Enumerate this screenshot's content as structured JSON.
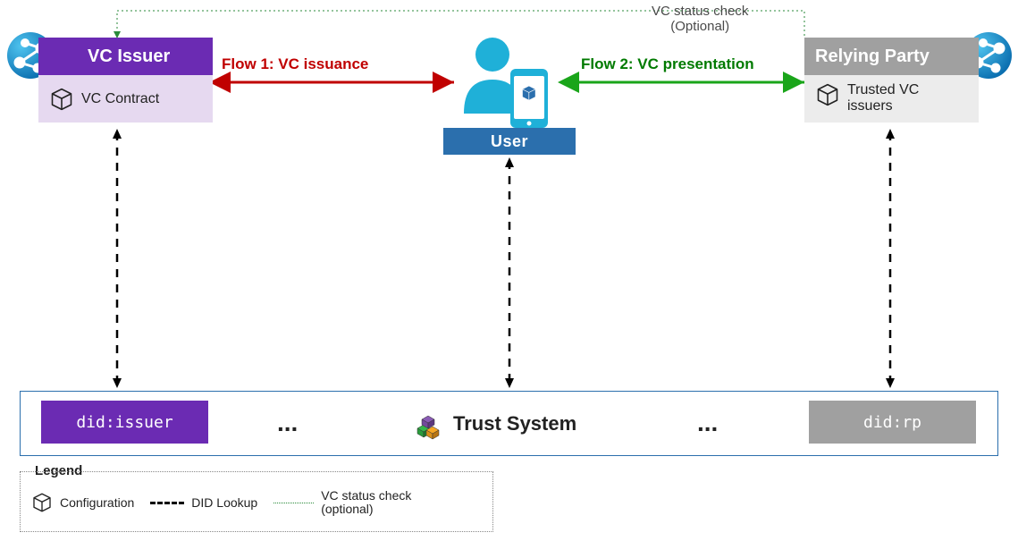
{
  "issuer": {
    "title": "VC Issuer",
    "contract": "VC Contract",
    "did": "did:issuer"
  },
  "relyingParty": {
    "title": "Relying Party",
    "trusted": "Trusted VC issuers",
    "did": "did:rp"
  },
  "user": {
    "label": "User"
  },
  "flows": {
    "flow1": "Flow 1: VC  issuance",
    "flow2": "Flow 2: VC presentation",
    "statusCheck": "VC status check\n(Optional)"
  },
  "trustSystem": {
    "label": "Trust System",
    "ellipsis": "..."
  },
  "legend": {
    "title": "Legend",
    "configuration": "Configuration",
    "didLookup": "DID Lookup",
    "statusCheck": "VC status check\n(optional)"
  },
  "colors": {
    "issuer": "#6b2bb3",
    "issuerLight": "#e6d9f0",
    "rp": "#a0a0a0",
    "userBar": "#2b6fad",
    "flow1": "#c00000",
    "flow2": "#1aa51a",
    "statusLine": "#2a8a3a"
  }
}
